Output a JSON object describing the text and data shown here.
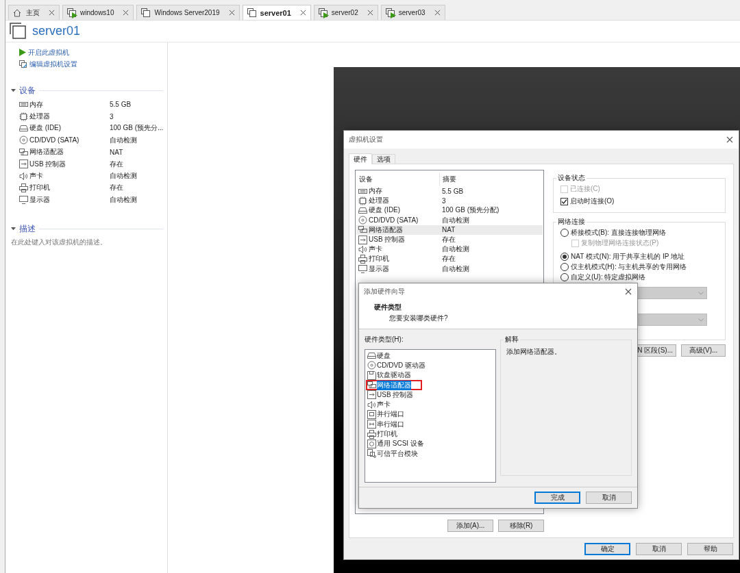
{
  "tabs": [
    {
      "label": "主页",
      "kind": "home",
      "selected": false,
      "running": false
    },
    {
      "label": "windows10",
      "kind": "vm",
      "selected": false,
      "running": true
    },
    {
      "label": "Windows Server2019",
      "kind": "vm",
      "selected": false,
      "running": false
    },
    {
      "label": "server01",
      "kind": "vm",
      "selected": true,
      "running": false
    },
    {
      "label": "server02",
      "kind": "vm",
      "selected": false,
      "running": true
    },
    {
      "label": "server03",
      "kind": "vm",
      "selected": false,
      "running": true
    }
  ],
  "vm": {
    "title": "server01",
    "actions": [
      {
        "label": "开启此虚拟机",
        "kind": "power"
      },
      {
        "label": "编辑虚拟机设置",
        "kind": "edit"
      }
    ],
    "devices_section": {
      "title": "设备",
      "expanded": true,
      "items": [
        {
          "name": "内存",
          "value": "5.5 GB",
          "kind": "memory"
        },
        {
          "name": "处理器",
          "value": "3",
          "kind": "cpu"
        },
        {
          "name": "硬盘 (IDE)",
          "value": "100 GB (预先分...",
          "kind": "disk"
        },
        {
          "name": "CD/DVD (SATA)",
          "value": "自动检测",
          "kind": "cdrom"
        },
        {
          "name": "网络适配器",
          "value": "NAT",
          "kind": "network"
        },
        {
          "name": "USB 控制器",
          "value": "存在",
          "kind": "usb"
        },
        {
          "name": "声卡",
          "value": "自动检测",
          "kind": "sound"
        },
        {
          "name": "打印机",
          "value": "存在",
          "kind": "printer"
        },
        {
          "name": "显示器",
          "value": "自动检测",
          "kind": "display"
        }
      ]
    },
    "description_section": {
      "title": "描述",
      "expanded": true,
      "placeholder": "在此处键入对该虚拟机的描述。"
    }
  },
  "settings_dialog": {
    "title": "虚拟机设置",
    "tabs": [
      {
        "label": "硬件",
        "selected": true
      },
      {
        "label": "选项",
        "selected": false
      }
    ],
    "device_table": {
      "columns": [
        "设备",
        "摘要"
      ],
      "rows": [
        {
          "name": "内存",
          "summary": "5.5 GB",
          "kind": "memory",
          "selected": false
        },
        {
          "name": "处理器",
          "summary": "3",
          "kind": "cpu",
          "selected": false
        },
        {
          "name": "硬盘 (IDE)",
          "summary": "100 GB (预先分配)",
          "kind": "disk",
          "selected": false
        },
        {
          "name": "CD/DVD (SATA)",
          "summary": "自动检测",
          "kind": "cdrom",
          "selected": false
        },
        {
          "name": "网络适配器",
          "summary": "NAT",
          "kind": "network",
          "selected": true
        },
        {
          "name": "USB 控制器",
          "summary": "存在",
          "kind": "usb",
          "selected": false
        },
        {
          "name": "声卡",
          "summary": "自动检测",
          "kind": "sound",
          "selected": false
        },
        {
          "name": "打印机",
          "summary": "存在",
          "kind": "printer",
          "selected": false
        },
        {
          "name": "显示器",
          "summary": "自动检测",
          "kind": "display",
          "selected": false
        }
      ]
    },
    "device_status": {
      "title": "设备状态",
      "options": [
        {
          "label": "已连接(C)",
          "checked": false,
          "disabled": true
        },
        {
          "label": "启动时连接(O)",
          "checked": true,
          "disabled": false
        }
      ]
    },
    "network_connection": {
      "title": "网络连接",
      "options": [
        {
          "kind": "radio",
          "label": "桥接模式(B): 直接连接物理网络",
          "selected": false,
          "disabled": false
        },
        {
          "kind": "checkbox",
          "label": "复制物理网络连接状态(P)",
          "checked": false,
          "disabled": true
        },
        {
          "kind": "radio",
          "label": "NAT 模式(N): 用于共享主机的 IP 地址",
          "selected": true,
          "disabled": false
        },
        {
          "kind": "radio",
          "label": "仅主机模式(H): 与主机共享的专用网络",
          "selected": false,
          "disabled": false
        },
        {
          "kind": "radio",
          "label": "自定义(U): 特定虚拟网络",
          "selected": false,
          "disabled": false
        }
      ],
      "dropdowns": [
        {
          "disabled": true
        },
        {
          "disabled": true
        }
      ],
      "buttons": [
        "N 区段(S)...",
        "高级(V)..."
      ]
    },
    "list_buttons": [
      "添加(A)...",
      "移除(R)"
    ],
    "buttons": [
      {
        "label": "确定",
        "default": true
      },
      {
        "label": "取消",
        "default": false
      },
      {
        "label": "帮助",
        "default": false
      }
    ]
  },
  "wizard": {
    "title": "添加硬件向导",
    "heading": "硬件类型",
    "subheading": "您要安装哪类硬件?",
    "list_label": "硬件类型(H):",
    "items": [
      {
        "label": "硬盘",
        "kind": "disk",
        "selected": false,
        "highlighted": false
      },
      {
        "label": "CD/DVD 驱动器",
        "kind": "cdrom",
        "selected": false,
        "highlighted": false
      },
      {
        "label": "软盘驱动器",
        "kind": "floppy",
        "selected": false,
        "highlighted": false
      },
      {
        "label": "网络适配器",
        "kind": "network",
        "selected": true,
        "highlighted": true
      },
      {
        "label": "USB 控制器",
        "kind": "usb",
        "selected": false,
        "highlighted": false
      },
      {
        "label": "声卡",
        "kind": "sound",
        "selected": false,
        "highlighted": false
      },
      {
        "label": "并行端口",
        "kind": "parallel",
        "selected": false,
        "highlighted": false
      },
      {
        "label": "串行端口",
        "kind": "serial",
        "selected": false,
        "highlighted": false
      },
      {
        "label": "打印机",
        "kind": "printer",
        "selected": false,
        "highlighted": false
      },
      {
        "label": "通用 SCSI 设备",
        "kind": "scsi",
        "selected": false,
        "highlighted": false
      },
      {
        "label": "可信平台模块",
        "kind": "tpm",
        "selected": false,
        "highlighted": false
      }
    ],
    "explanation": {
      "title": "解释",
      "text": "添加网络适配器。"
    },
    "buttons": [
      {
        "label": "完成",
        "default": true
      },
      {
        "label": "取消",
        "default": false
      }
    ]
  }
}
